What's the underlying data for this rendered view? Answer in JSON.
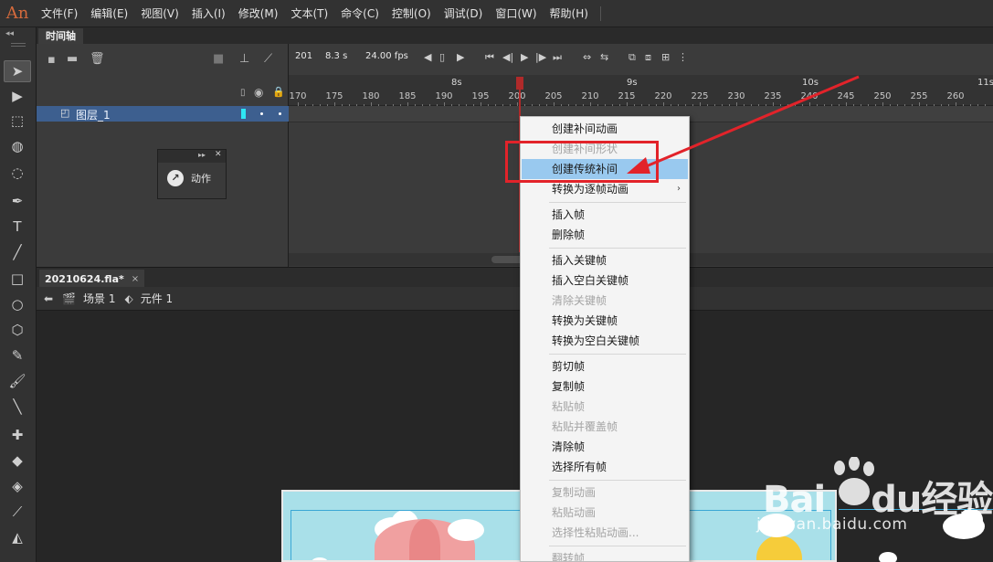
{
  "menubar": {
    "logo": "An",
    "items": [
      "文件(F)",
      "编辑(E)",
      "视图(V)",
      "插入(I)",
      "修改(M)",
      "文本(T)",
      "命令(C)",
      "控制(O)",
      "调试(D)",
      "窗口(W)",
      "帮助(H)"
    ]
  },
  "toolbar": {
    "collapse": "◂◂",
    "tools": [
      {
        "icon": "selection-tool-icon",
        "glyph": "➤"
      },
      {
        "icon": "subselection-tool-icon",
        "glyph": "▶"
      },
      {
        "icon": "free-transform-tool-icon",
        "glyph": "⬚"
      },
      {
        "icon": "3d-rotation-tool-icon",
        "glyph": "◍"
      },
      {
        "icon": "lasso-tool-icon",
        "glyph": "◌"
      },
      {
        "icon": "pen-tool-icon",
        "glyph": "✒"
      },
      {
        "icon": "text-tool-icon",
        "glyph": "T"
      },
      {
        "icon": "line-tool-icon",
        "glyph": "╱"
      },
      {
        "icon": "rectangle-tool-icon",
        "glyph": "□"
      },
      {
        "icon": "oval-tool-icon",
        "glyph": "○"
      },
      {
        "icon": "polystar-tool-icon",
        "glyph": "⬡"
      },
      {
        "icon": "pencil-tool-icon",
        "glyph": "✎"
      },
      {
        "icon": "paint-brush-tool-icon",
        "glyph": "🖌"
      },
      {
        "icon": "brush-tool-icon",
        "glyph": "╲"
      },
      {
        "icon": "bone-tool-icon",
        "glyph": "✚"
      },
      {
        "icon": "paint-bucket-tool-icon",
        "glyph": "◆"
      },
      {
        "icon": "ink-bottle-tool-icon",
        "glyph": "◈"
      },
      {
        "icon": "eyedropper-tool-icon",
        "glyph": "⟋"
      },
      {
        "icon": "eraser-tool-icon",
        "glyph": "◭"
      },
      {
        "icon": "width-tool-icon",
        "glyph": "⌗"
      }
    ]
  },
  "timeline": {
    "tab_label": "时间轴",
    "layer_name": "图层_1",
    "current_frame": "201",
    "elapsed_time": "8.3 s",
    "fps": "24.00 fps",
    "second_markers": [
      {
        "label": "8s",
        "frame": 192
      },
      {
        "label": "9s",
        "frame": 216
      },
      {
        "label": "10s",
        "frame": 240
      },
      {
        "label": "11s",
        "frame": 264
      }
    ],
    "frame_numbers": [
      "170",
      "175",
      "180",
      "185",
      "190",
      "195",
      "200",
      "205",
      "210",
      "215",
      "220",
      "225",
      "230",
      "235",
      "240",
      "245",
      "250",
      "255",
      "260"
    ]
  },
  "actions_panel": {
    "expand": "▸▸",
    "close": "✕",
    "label": "动作"
  },
  "document": {
    "tab_label": "20210624.fla*",
    "close": "×",
    "breadcrumbs": [
      {
        "icon": "scene-icon",
        "label": "场景 1"
      },
      {
        "icon": "symbol-icon",
        "label": "元件 1"
      }
    ]
  },
  "context_menu": {
    "items": [
      {
        "label": "创建补间动画",
        "disabled": false
      },
      {
        "label": "创建补间形状",
        "disabled": true
      },
      {
        "label": "创建传统补间",
        "disabled": false,
        "highlight": true
      },
      {
        "label": "转换为逐帧动画",
        "disabled": false,
        "submenu": true
      },
      {
        "sep": true
      },
      {
        "label": "插入帧",
        "disabled": false
      },
      {
        "label": "删除帧",
        "disabled": false
      },
      {
        "sep": true
      },
      {
        "label": "插入关键帧",
        "disabled": false
      },
      {
        "label": "插入空白关键帧",
        "disabled": false
      },
      {
        "label": "清除关键帧",
        "disabled": true
      },
      {
        "label": "转换为关键帧",
        "disabled": false
      },
      {
        "label": "转换为空白关键帧",
        "disabled": false
      },
      {
        "sep": true
      },
      {
        "label": "剪切帧",
        "disabled": false
      },
      {
        "label": "复制帧",
        "disabled": false
      },
      {
        "label": "粘贴帧",
        "disabled": true
      },
      {
        "label": "粘贴并覆盖帧",
        "disabled": true
      },
      {
        "label": "清除帧",
        "disabled": false
      },
      {
        "label": "选择所有帧",
        "disabled": false
      },
      {
        "sep": true
      },
      {
        "label": "复制动画",
        "disabled": true
      },
      {
        "label": "粘贴动画",
        "disabled": true
      },
      {
        "label": "选择性粘贴动画...",
        "disabled": true
      },
      {
        "sep": true
      },
      {
        "label": "翻转帧",
        "disabled": true
      }
    ]
  },
  "watermark": {
    "logo": "Bai",
    "logo_tail": "du经验",
    "url": "jingyan.baidu.com"
  },
  "colors": {
    "annotation": "#e2232a",
    "layer_selected": "#3d5f8f",
    "menu_highlight": "#99c9ef",
    "playhead": "#b02a2a"
  }
}
